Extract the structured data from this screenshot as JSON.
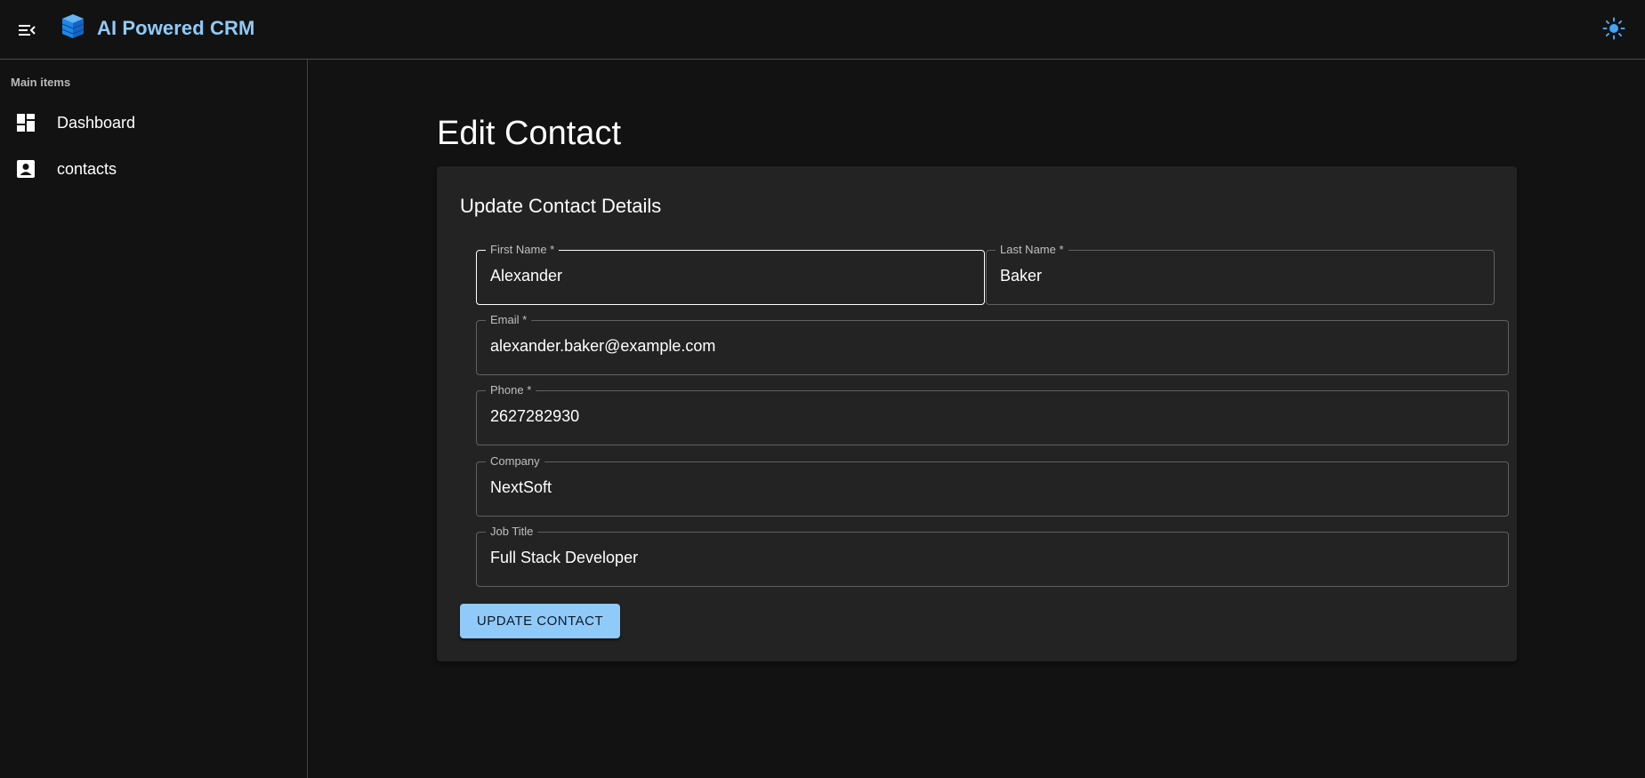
{
  "app": {
    "title": "AI Powered CRM",
    "logo_icon": "stacked-blocks-logo-icon",
    "menu_icon": "menu-collapse-icon",
    "theme_icon": "sun-icon",
    "accent_color": "#90caf9"
  },
  "sidebar": {
    "header": "Main items",
    "items": [
      {
        "label": "Dashboard",
        "icon": "dashboard-icon"
      },
      {
        "label": "contacts",
        "icon": "contact-card-icon"
      }
    ]
  },
  "page": {
    "title": "Edit Contact"
  },
  "form": {
    "title": "Update Contact Details",
    "fields": {
      "first_name": {
        "label": "First Name *",
        "value": "Alexander"
      },
      "last_name": {
        "label": "Last Name *",
        "value": "Baker"
      },
      "email": {
        "label": "Email *",
        "value": "alexander.baker@example.com"
      },
      "phone": {
        "label": "Phone *",
        "value": "2627282930"
      },
      "company": {
        "label": "Company",
        "value": "NextSoft"
      },
      "job_title": {
        "label": "Job Title",
        "value": "Full Stack Developer"
      }
    },
    "submit_label": "Update Contact"
  }
}
